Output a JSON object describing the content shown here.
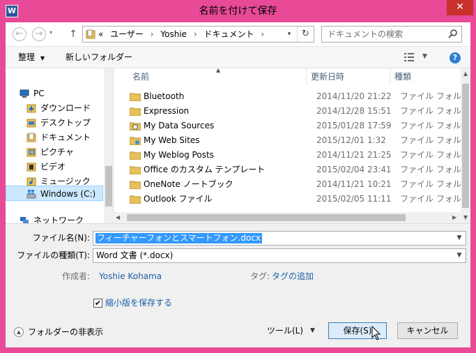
{
  "window": {
    "title": "名前を付けて保存",
    "app_icon_letter": "W",
    "close_glyph": "✕"
  },
  "nav": {
    "back_glyph": "←",
    "forward_glyph": "→",
    "up_glyph": "↑",
    "breadcrumb": [
      "«",
      "ユーザー",
      "›",
      "Yoshie",
      "›",
      "ドキュメント",
      "›"
    ],
    "search_placeholder": "ドキュメントの検索"
  },
  "toolbar": {
    "organize_label": "整理",
    "new_folder_label": "新しいフォルダー",
    "help_glyph": "?"
  },
  "navpane": {
    "items": [
      {
        "label": "PC",
        "icon": "pc-icon"
      },
      {
        "label": "ダウンロード",
        "icon": "downloads-icon"
      },
      {
        "label": "デスクトップ",
        "icon": "desktop-icon"
      },
      {
        "label": "ドキュメント",
        "icon": "documents-icon"
      },
      {
        "label": "ピクチャ",
        "icon": "pictures-icon"
      },
      {
        "label": "ビデオ",
        "icon": "videos-icon"
      },
      {
        "label": "ミュージック",
        "icon": "music-icon"
      },
      {
        "label": "Windows (C:)",
        "icon": "drive-icon"
      },
      {
        "label": "ネットワーク",
        "icon": "network-icon"
      }
    ]
  },
  "filelist": {
    "columns": [
      "名前",
      "更新日時",
      "種類"
    ],
    "rows": [
      {
        "name": "Bluetooth",
        "date": "2014/11/20 21:22",
        "type": "ファイル フォルダー",
        "icon": "folder-icon"
      },
      {
        "name": "Expression",
        "date": "2014/12/28 15:51",
        "type": "ファイル フォルダー",
        "icon": "folder-icon"
      },
      {
        "name": "My Data Sources",
        "date": "2015/01/28 17:59",
        "type": "ファイル フォルダー",
        "icon": "data-sources-folder-icon"
      },
      {
        "name": "My Web Sites",
        "date": "2015/12/01 1:32",
        "type": "ファイル フォルダー",
        "icon": "web-folder-icon"
      },
      {
        "name": "My Weblog Posts",
        "date": "2014/11/21 21:25",
        "type": "ファイル フォルダー",
        "icon": "folder-icon"
      },
      {
        "name": "Office のカスタム テンプレート",
        "date": "2015/02/04 23:41",
        "type": "ファイル フォルダー",
        "icon": "folder-icon"
      },
      {
        "name": "OneNote ノートブック",
        "date": "2014/11/21 10:21",
        "type": "ファイル フォルダー",
        "icon": "folder-icon"
      },
      {
        "name": "Outlook ファイル",
        "date": "2015/02/05 11:11",
        "type": "ファイル フォルダー",
        "icon": "folder-icon"
      }
    ]
  },
  "form": {
    "filename_label": "ファイル名(N):",
    "filename_value": "フィーチャーフォンとスマートフォン.docx",
    "filetype_label": "ファイルの種類(T):",
    "filetype_value": "Word 文書 (*.docx)",
    "author_label": "作成者:",
    "author_value": "Yoshie Kohama",
    "tags_label": "タグ:",
    "tags_value": "タグの追加",
    "thumbnail_label": "縮小版を保存する",
    "thumbnail_checked": true
  },
  "footer": {
    "hide_folders_label": "フォルダーの非表示",
    "tools_label": "ツール(L)",
    "save_label": "保存(S)",
    "cancel_label": "キャンセル"
  },
  "colors": {
    "accent_frame": "#e84a97",
    "close_button": "#c7302b",
    "selection": "#3399ff",
    "link": "#1a5ea8"
  }
}
